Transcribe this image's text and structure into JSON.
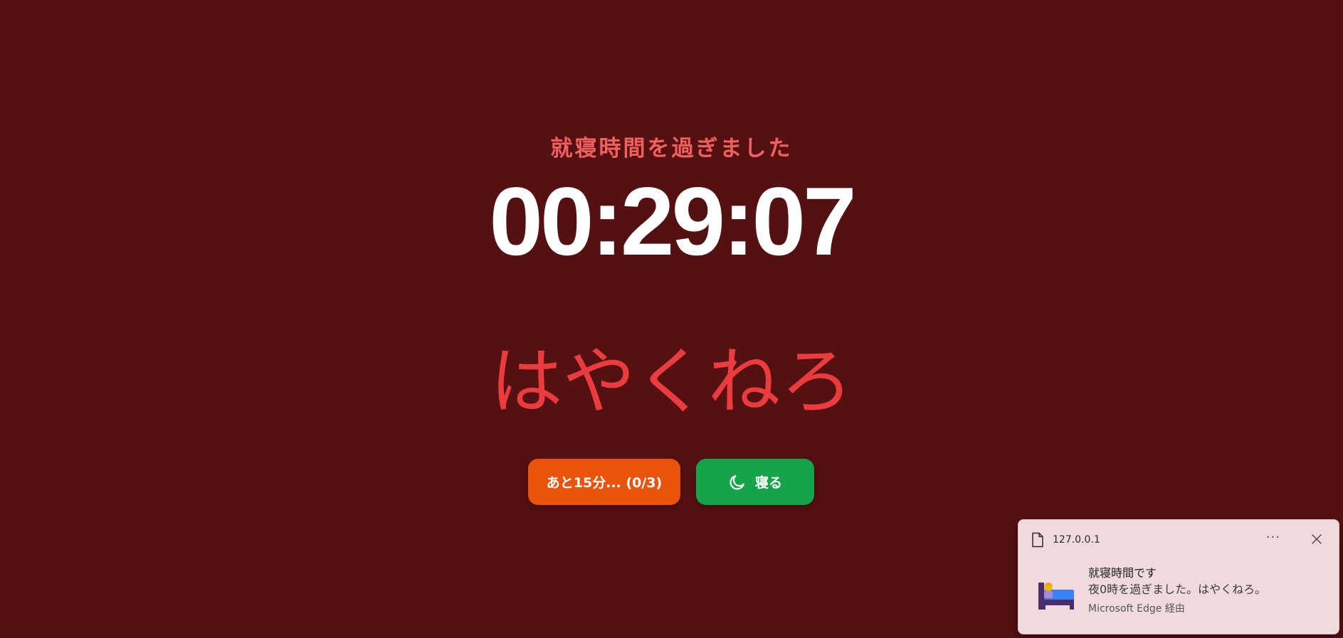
{
  "page": {
    "subtitle": "就寝時間を過ぎました",
    "timer": "00:29:07",
    "slogan": "はやくねろ"
  },
  "buttons": {
    "snooze_label": "あと15分... (0/3)",
    "sleep_label": "寝る",
    "sleep_icon": "moon-icon"
  },
  "colors": {
    "background": "#551012",
    "subtitle": "#f0605e",
    "slogan": "#ea3c3e",
    "snooze_button": "#e9540c",
    "sleep_button": "#16a34a"
  },
  "notification": {
    "source": "127.0.0.1",
    "more_label": "···",
    "title": "就寝時間です",
    "message": "夜0時を過ぎました。はやくねろ。",
    "via": "Microsoft Edge 経由",
    "icon": "bed-icon"
  }
}
